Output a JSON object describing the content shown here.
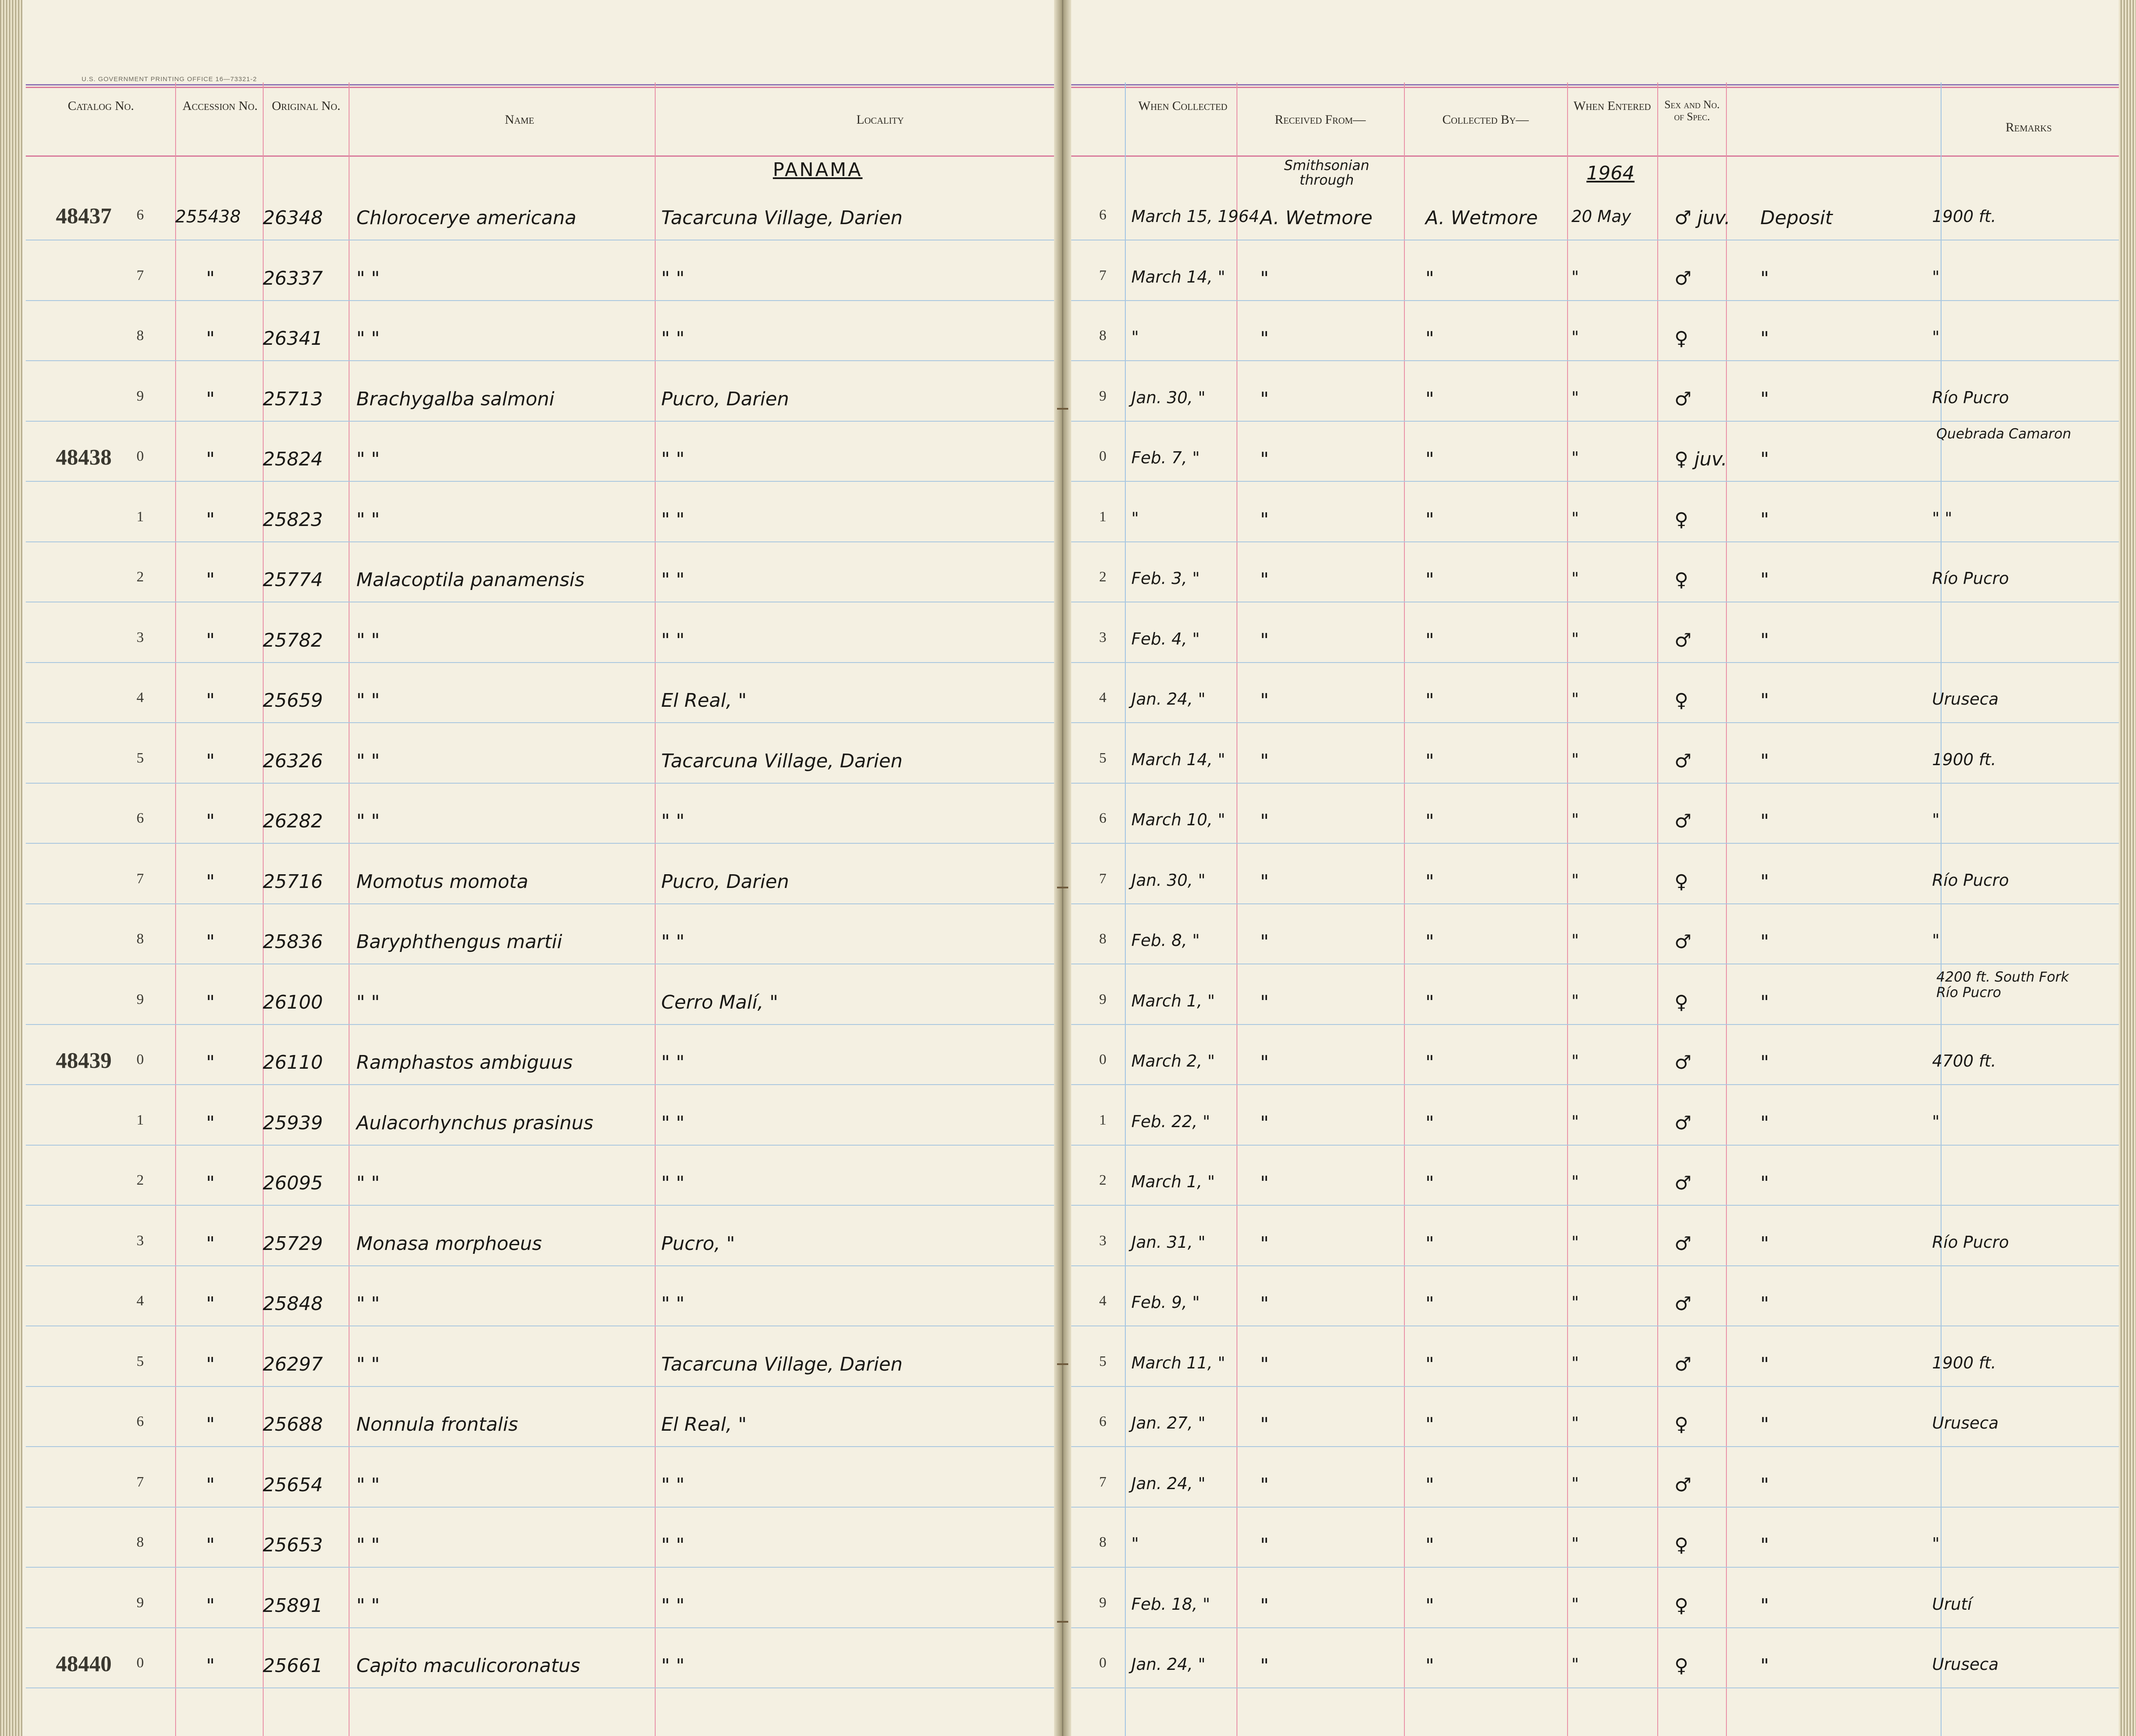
{
  "printing_office": "U.S. GOVERNMENT PRINTING OFFICE   16—73321-2",
  "headers": {
    "catalog": "Catalog No.",
    "accession": "Accession No.",
    "original": "Original No.",
    "name": "Name",
    "locality": "Locality",
    "when_collected": "When Collected",
    "received_from": "Received From—",
    "collected_by": "Collected By—",
    "when_entered": "When Entered",
    "sex_spec": "Sex and No. of Spec.",
    "remarks": "Remarks"
  },
  "annotations": {
    "country": "PANAMA",
    "received_note": "Smithsonian through",
    "year_entered": "1964"
  },
  "rows": [
    {
      "cat": "48437",
      "idx": "6",
      "acc": "255438",
      "orig": "26348",
      "name": "Chlorocerye americana",
      "loc": "Tacarcuna Village, Darien",
      "date": "March 15, 1964",
      "recv": "A. Wetmore",
      "coll": "A. Wetmore",
      "entered": "20 May",
      "sex": "♂ juv.",
      "status": "Deposit",
      "remark": "1900 ft."
    },
    {
      "cat": "",
      "idx": "7",
      "acc": "\"",
      "orig": "26337",
      "name": "\"   \"",
      "loc": "\"   \"",
      "date": "March 14, \"",
      "recv": "\"",
      "coll": "\"",
      "entered": "\"",
      "sex": "♂",
      "status": "\"",
      "remark": "\""
    },
    {
      "cat": "",
      "idx": "8",
      "acc": "\"",
      "orig": "26341",
      "name": "\"   \"",
      "loc": "\"   \"",
      "date": "\"",
      "recv": "\"",
      "coll": "\"",
      "entered": "\"",
      "sex": "♀",
      "status": "\"",
      "remark": "\""
    },
    {
      "cat": "",
      "idx": "9",
      "acc": "\"",
      "orig": "25713",
      "name": "Brachygalba salmoni",
      "loc": "Pucro, Darien",
      "date": "Jan. 30, \"",
      "recv": "\"",
      "coll": "\"",
      "entered": "\"",
      "sex": "♂",
      "status": "\"",
      "remark": "Río Pucro"
    },
    {
      "cat": "48438",
      "idx": "0",
      "acc": "\"",
      "orig": "25824",
      "name": "\"   \"",
      "loc": "\"   \"",
      "date": "Feb. 7, \"",
      "recv": "\"",
      "coll": "\"",
      "entered": "\"",
      "sex": "♀ juv.",
      "status": "\"",
      "remark": "Quebrada Camaron"
    },
    {
      "cat": "",
      "idx": "1",
      "acc": "\"",
      "orig": "25823",
      "name": "\"   \"",
      "loc": "\"   \"",
      "date": "\"",
      "recv": "\"",
      "coll": "\"",
      "entered": "\"",
      "sex": "♀",
      "status": "\"",
      "remark": "\"   \""
    },
    {
      "cat": "",
      "idx": "2",
      "acc": "\"",
      "orig": "25774",
      "name": "Malacoptila panamensis",
      "loc": "\"   \"",
      "date": "Feb. 3, \"",
      "recv": "\"",
      "coll": "\"",
      "entered": "\"",
      "sex": "♀",
      "status": "\"",
      "remark": "Río Pucro"
    },
    {
      "cat": "",
      "idx": "3",
      "acc": "\"",
      "orig": "25782",
      "name": "\"   \"",
      "loc": "\"   \"",
      "date": "Feb. 4, \"",
      "recv": "\"",
      "coll": "\"",
      "entered": "\"",
      "sex": "♂",
      "status": "\"",
      "remark": ""
    },
    {
      "cat": "",
      "idx": "4",
      "acc": "\"",
      "orig": "25659",
      "name": "\"   \"",
      "loc": "El Real,  \"",
      "date": "Jan. 24, \"",
      "recv": "\"",
      "coll": "\"",
      "entered": "\"",
      "sex": "♀",
      "status": "\"",
      "remark": "Uruseca"
    },
    {
      "cat": "",
      "idx": "5",
      "acc": "\"",
      "orig": "26326",
      "name": "\"   \"",
      "loc": "Tacarcuna Village, Darien",
      "date": "March 14, \"",
      "recv": "\"",
      "coll": "\"",
      "entered": "\"",
      "sex": "♂",
      "status": "\"",
      "remark": "1900 ft."
    },
    {
      "cat": "",
      "idx": "6",
      "acc": "\"",
      "orig": "26282",
      "name": "\"   \"",
      "loc": "\"   \"",
      "date": "March 10, \"",
      "recv": "\"",
      "coll": "\"",
      "entered": "\"",
      "sex": "♂",
      "status": "\"",
      "remark": "\""
    },
    {
      "cat": "",
      "idx": "7",
      "acc": "\"",
      "orig": "25716",
      "name": "Momotus momota",
      "loc": "Pucro, Darien",
      "date": "Jan. 30, \"",
      "recv": "\"",
      "coll": "\"",
      "entered": "\"",
      "sex": "♀",
      "status": "\"",
      "remark": "Río Pucro"
    },
    {
      "cat": "",
      "idx": "8",
      "acc": "\"",
      "orig": "25836",
      "name": "Baryphthengus martii",
      "loc": "\"   \"",
      "date": "Feb. 8, \"",
      "recv": "\"",
      "coll": "\"",
      "entered": "\"",
      "sex": "♂",
      "status": "\"",
      "remark": "\""
    },
    {
      "cat": "",
      "idx": "9",
      "acc": "\"",
      "orig": "26100",
      "name": "\"   \"",
      "loc": "Cerro Malí,  \"",
      "date": "March 1, \"",
      "recv": "\"",
      "coll": "\"",
      "entered": "\"",
      "sex": "♀",
      "status": "\"",
      "remark": "4200 ft. South Fork Río Pucro"
    },
    {
      "cat": "48439",
      "idx": "0",
      "acc": "\"",
      "orig": "26110",
      "name": "Ramphastos ambiguus",
      "loc": "\"   \"",
      "date": "March 2, \"",
      "recv": "\"",
      "coll": "\"",
      "entered": "\"",
      "sex": "♂",
      "status": "\"",
      "remark": "4700 ft."
    },
    {
      "cat": "",
      "idx": "1",
      "acc": "\"",
      "orig": "25939",
      "name": "Aulacorhynchus prasinus",
      "loc": "\"   \"",
      "date": "Feb. 22, \"",
      "recv": "\"",
      "coll": "\"",
      "entered": "\"",
      "sex": "♂",
      "status": "\"",
      "remark": "\""
    },
    {
      "cat": "",
      "idx": "2",
      "acc": "\"",
      "orig": "26095",
      "name": "\"   \"",
      "loc": "\"   \"",
      "date": "March 1, \"",
      "recv": "\"",
      "coll": "\"",
      "entered": "\"",
      "sex": "♂",
      "status": "\"",
      "remark": ""
    },
    {
      "cat": "",
      "idx": "3",
      "acc": "\"",
      "orig": "25729",
      "name": "Monasa morphoeus",
      "loc": "Pucro,  \"",
      "date": "Jan. 31, \"",
      "recv": "\"",
      "coll": "\"",
      "entered": "\"",
      "sex": "♂",
      "status": "\"",
      "remark": "Río Pucro"
    },
    {
      "cat": "",
      "idx": "4",
      "acc": "\"",
      "orig": "25848",
      "name": "\"   \"",
      "loc": "\"   \"",
      "date": "Feb. 9, \"",
      "recv": "\"",
      "coll": "\"",
      "entered": "\"",
      "sex": "♂",
      "status": "\"",
      "remark": ""
    },
    {
      "cat": "",
      "idx": "5",
      "acc": "\"",
      "orig": "26297",
      "name": "\"   \"",
      "loc": "Tacarcuna Village, Darien",
      "date": "March 11, \"",
      "recv": "\"",
      "coll": "\"",
      "entered": "\"",
      "sex": "♂",
      "status": "\"",
      "remark": "1900 ft."
    },
    {
      "cat": "",
      "idx": "6",
      "acc": "\"",
      "orig": "25688",
      "name": "Nonnula frontalis",
      "loc": "El Real,  \"",
      "date": "Jan. 27, \"",
      "recv": "\"",
      "coll": "\"",
      "entered": "\"",
      "sex": "♀",
      "status": "\"",
      "remark": "Uruseca"
    },
    {
      "cat": "",
      "idx": "7",
      "acc": "\"",
      "orig": "25654",
      "name": "\"   \"",
      "loc": "\"   \"",
      "date": "Jan. 24, \"",
      "recv": "\"",
      "coll": "\"",
      "entered": "\"",
      "sex": "♂",
      "status": "\"",
      "remark": ""
    },
    {
      "cat": "",
      "idx": "8",
      "acc": "\"",
      "orig": "25653",
      "name": "\"   \"",
      "loc": "\"   \"",
      "date": "\"",
      "recv": "\"",
      "coll": "\"",
      "entered": "\"",
      "sex": "♀",
      "status": "\"",
      "remark": "\""
    },
    {
      "cat": "",
      "idx": "9",
      "acc": "\"",
      "orig": "25891",
      "name": "\"   \"",
      "loc": "\"   \"",
      "date": "Feb. 18, \"",
      "recv": "\"",
      "coll": "\"",
      "entered": "\"",
      "sex": "♀",
      "status": "\"",
      "remark": "Urutí"
    },
    {
      "cat": "48440",
      "idx": "0",
      "acc": "\"",
      "orig": "25661",
      "name": "Capito maculicoronatus",
      "loc": "\"   \"",
      "date": "Jan. 24, \"",
      "recv": "\"",
      "coll": "\"",
      "entered": "\"",
      "sex": "♀",
      "status": "\"",
      "remark": "Uruseca"
    }
  ]
}
